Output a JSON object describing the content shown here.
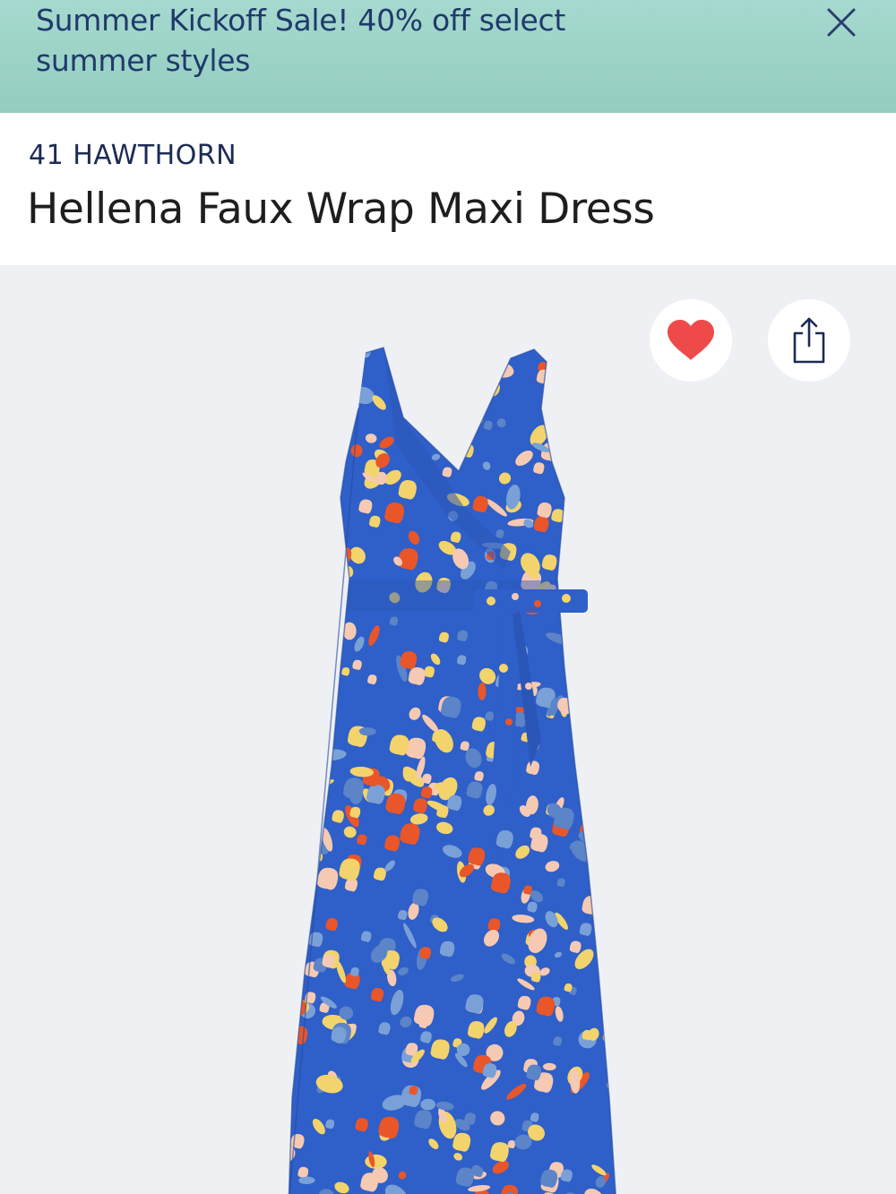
{
  "banner": {
    "text_line1": "Summer Kickoff Sale! 40% off select",
    "text_line2": "summer styles",
    "close_icon": "close-icon"
  },
  "product": {
    "brand": "41 HAWTHORN",
    "title": "Hellena Faux Wrap Maxi Dress"
  },
  "actions": {
    "favorite_icon": "heart-icon",
    "share_icon": "share-icon"
  },
  "colors": {
    "banner_bg": "#9fd4c8",
    "brand_text": "#1c2b55",
    "heart": "#ef4a4a",
    "image_bg": "#eef0f4",
    "dress_blue": "#2f5fc8"
  }
}
